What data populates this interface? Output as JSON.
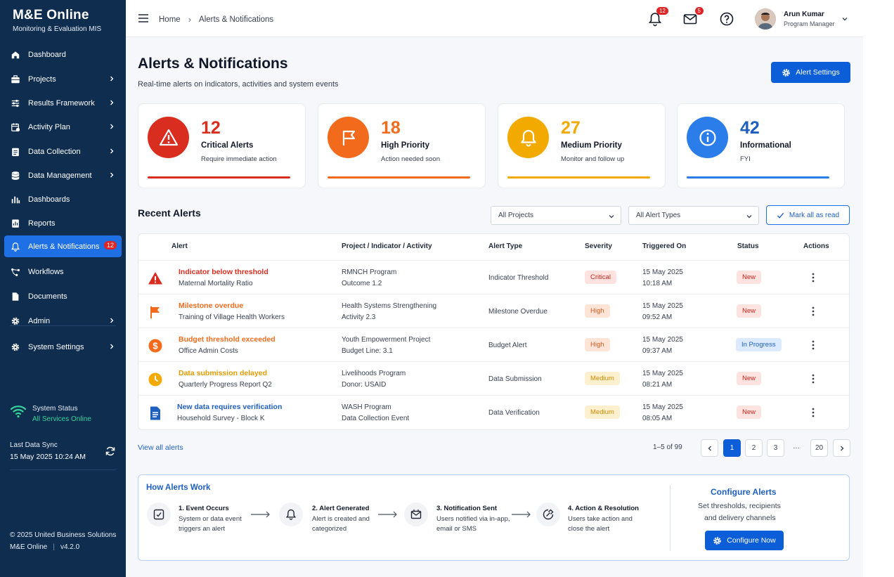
{
  "brand": {
    "title": "M&E Online",
    "subtitle": "Monitoring & Evaluation MIS"
  },
  "nav": [
    {
      "label": "Dashboard",
      "icon": "home-icon",
      "chevron": false
    },
    {
      "label": "Projects",
      "icon": "briefcase-icon",
      "chevron": true
    },
    {
      "label": "Results Framework",
      "icon": "sliders-icon",
      "chevron": true
    },
    {
      "label": "Activity Plan",
      "icon": "calendar-icon",
      "chevron": true
    },
    {
      "label": "Data Collection",
      "icon": "clipboard-icon",
      "chevron": true
    },
    {
      "label": "Data Management",
      "icon": "database-icon",
      "chevron": true
    },
    {
      "label": "Dashboards",
      "icon": "bar-chart-icon",
      "chevron": false
    },
    {
      "label": "Reports",
      "icon": "report-icon",
      "chevron": false
    },
    {
      "label": "Alerts & Notifications",
      "icon": "bell-icon",
      "chevron": false,
      "badge": "12",
      "active": true
    },
    {
      "label": "Workflows",
      "icon": "workflow-icon",
      "chevron": false
    },
    {
      "label": "Documents",
      "icon": "document-icon",
      "chevron": false
    },
    {
      "label": "Admin",
      "icon": "gear-icon",
      "chevron": true
    },
    {
      "label": "System Settings",
      "icon": "settings-icon",
      "chevron": true
    }
  ],
  "system_status": {
    "label": "System Status",
    "value": "All Services Online"
  },
  "sync": {
    "label": "Last Data Sync",
    "value": "15 May 2025 10:24 AM"
  },
  "footer": {
    "copyright": "© 2025 United Business Solutions",
    "app": "M&E Online",
    "version": "v4.2.0"
  },
  "topbar": {
    "breadcrumb_home": "Home",
    "breadcrumb_current": "Alerts & Notifications",
    "notif_count": "12",
    "mail_count": "5",
    "user_name": "Arun Kumar",
    "user_role": "Program Manager"
  },
  "page": {
    "title": "Alerts & Notifications",
    "subtitle": "Real-time alerts on indicators, activities and system events",
    "settings_label": "Alert Settings"
  },
  "cards": [
    {
      "count": "12",
      "title": "Critical Alerts",
      "desc": "Require immediate action",
      "color": "#d92d20",
      "icon": "warning-triangle-icon"
    },
    {
      "count": "18",
      "title": "High Priority",
      "desc": "Action needed soon",
      "color": "#f26b1d",
      "icon": "flag-icon"
    },
    {
      "count": "27",
      "title": "Medium Priority",
      "desc": "Monitor and follow up",
      "color": "#f2a900",
      "icon": "bell-icon"
    },
    {
      "count": "42",
      "title": "Informational",
      "desc": "FYI",
      "color": "#2b7de9",
      "icon": "info-icon"
    }
  ],
  "recent": {
    "title": "Recent Alerts",
    "filter_projects": "All Projects",
    "filter_types": "All Alert Types",
    "mark_read": "Mark all as read"
  },
  "table": {
    "headers": [
      "Alert",
      "Project / Indicator / Activity",
      "Alert Type",
      "Severity",
      "Triggered On",
      "Status",
      "Actions"
    ],
    "rows": [
      {
        "title": "Indicator below threshold",
        "sub": "Maternal Mortality Ratio",
        "proj": "RMNCH Program",
        "proj2": "Outcome 1.2",
        "type": "Indicator Threshold",
        "severity": "Critical",
        "date": "15 May 2025",
        "time": "10:18 AM",
        "status": "New",
        "icon": "warning-triangle-icon",
        "color": "#d92d20"
      },
      {
        "title": "Milestone overdue",
        "sub": "Training of Village Health Workers",
        "proj": "Health Systems Strengthening",
        "proj2": "Activity 2.3",
        "type": "Milestone Overdue",
        "severity": "High",
        "date": "15 May 2025",
        "time": "09:52 AM",
        "status": "New",
        "icon": "flag-icon",
        "color": "#f26b1d"
      },
      {
        "title": "Budget threshold exceeded",
        "sub": "Office Admin Costs",
        "proj": "Youth Empowerment Project",
        "proj2": "Budget Line: 3.1",
        "type": "Budget Alert",
        "severity": "High",
        "date": "15 May 2025",
        "time": "09:37 AM",
        "status": "In Progress",
        "icon": "dollar-icon",
        "color": "#f26b1d"
      },
      {
        "title": "Data submission delayed",
        "sub": "Quarterly Progress Report Q2",
        "proj": "Livelihoods Program",
        "proj2": "Donor: USAID",
        "type": "Data Submission",
        "severity": "Medium",
        "date": "15 May 2025",
        "time": "08:21 AM",
        "status": "New",
        "icon": "clock-icon",
        "color": "#f2a900"
      },
      {
        "title": "New data requires verification",
        "sub": "Household Survey - Block K",
        "proj": "WASH Program",
        "proj2": "Data Collection Event",
        "type": "Data Verification",
        "severity": "Medium",
        "date": "15 May 2025",
        "time": "08:05 AM",
        "status": "New",
        "icon": "document-icon",
        "color": "#1f5fbf"
      }
    ]
  },
  "pagination": {
    "view_all": "View all alerts",
    "info": "1–5 of 99",
    "pages": [
      "1",
      "2",
      "3",
      "20"
    ],
    "dots": "…"
  },
  "how": {
    "title": "How Alerts Work",
    "steps": [
      {
        "title": "1. Event Occurs",
        "l1": "System or data event",
        "l2": "triggers an alert"
      },
      {
        "title": "2. Alert Generated",
        "l1": "Alert is created and",
        "l2": "categorized"
      },
      {
        "title": "3. Notification Sent",
        "l1": "Users notified via in-app,",
        "l2": "email or SMS"
      },
      {
        "title": "4. Action & Resolution",
        "l1": "Users take action and",
        "l2": "close the alert"
      }
    ],
    "configure_title": "Configure Alerts",
    "configure_l1": "Set thresholds, recipients",
    "configure_l2": "and delivery channels",
    "configure_button": "Configure Now"
  }
}
